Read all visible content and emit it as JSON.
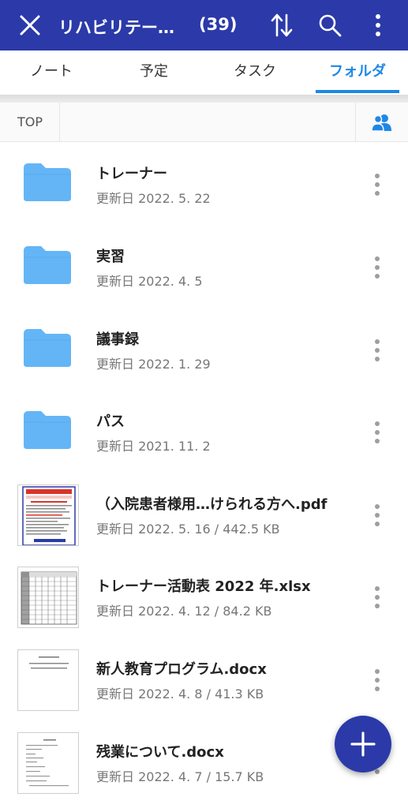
{
  "header": {
    "title": "リハビリテー…",
    "count": "(39)",
    "close_icon": "close-icon",
    "sort_icon": "sort-icon",
    "search_icon": "search-icon",
    "more_icon": "more-vert-icon"
  },
  "tabs": [
    {
      "label": "ノート",
      "active": false
    },
    {
      "label": "予定",
      "active": false
    },
    {
      "label": "タスク",
      "active": false
    },
    {
      "label": "フォルダ",
      "active": true
    }
  ],
  "path": {
    "root": "TOP",
    "share_icon": "people-icon"
  },
  "items": [
    {
      "type": "folder",
      "name": "トレーナー",
      "meta": "更新日 2022. 5. 22"
    },
    {
      "type": "folder",
      "name": "実習",
      "meta": "更新日 2022. 4. 5"
    },
    {
      "type": "folder",
      "name": "議事録",
      "meta": "更新日 2022. 1. 29"
    },
    {
      "type": "folder",
      "name": "パス",
      "meta": "更新日 2021. 11. 2"
    },
    {
      "type": "pdf",
      "name": "（入院患者様用…けられる方へ.pdf",
      "meta": "更新日 2022. 5. 16 / 442.5 KB"
    },
    {
      "type": "xlsx",
      "name": "トレーナー活動表 2022 年.xlsx",
      "meta": "更新日 2022. 4. 12 / 84.2 KB"
    },
    {
      "type": "docx",
      "name": "新人教育プログラム.docx",
      "meta": "更新日 2022. 4. 8 / 41.3 KB"
    },
    {
      "type": "docx",
      "name": "残業について.docx",
      "meta": "更新日 2022. 4. 7 / 15.7 KB"
    }
  ],
  "fab": {
    "icon": "add-icon"
  },
  "colors": {
    "appbar": "#2b3aa8",
    "accent": "#1e88e5",
    "folder": "#64b5f6"
  }
}
